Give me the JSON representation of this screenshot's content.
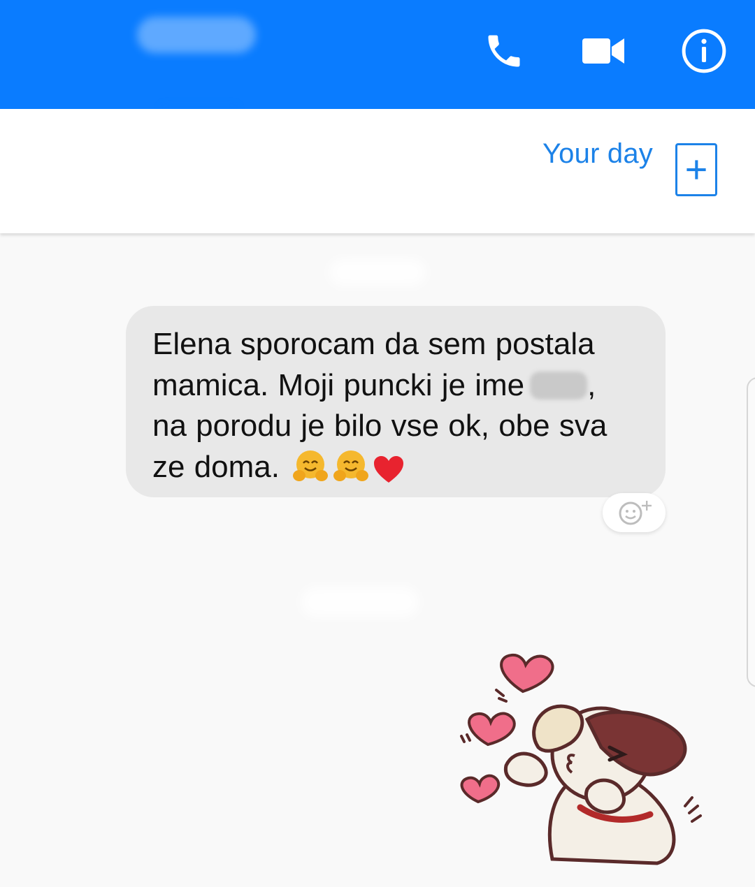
{
  "header": {
    "icons": [
      "phone-icon",
      "video-camera-icon",
      "info-icon"
    ],
    "accent_color": "#0a7cff"
  },
  "your_day": {
    "label": "Your day",
    "add_icon": "plus-icon",
    "color": "#1c82e8"
  },
  "message": {
    "lines": [
      "Elena sporocam da sem postala",
      "mamica. Moji puncki je  ime",
      "na porodu je bilo vse ok, obe sva",
      "ze doma."
    ],
    "after_redaction": ",",
    "emojis": [
      "hugging-face-emoji",
      "hugging-face-emoji",
      "red-heart-emoji"
    ],
    "bubble_color": "#e8e8e8"
  },
  "reaction": {
    "icon": "add-reaction-icon"
  },
  "sticker": {
    "name": "kissing-dog-hearts-sticker"
  }
}
